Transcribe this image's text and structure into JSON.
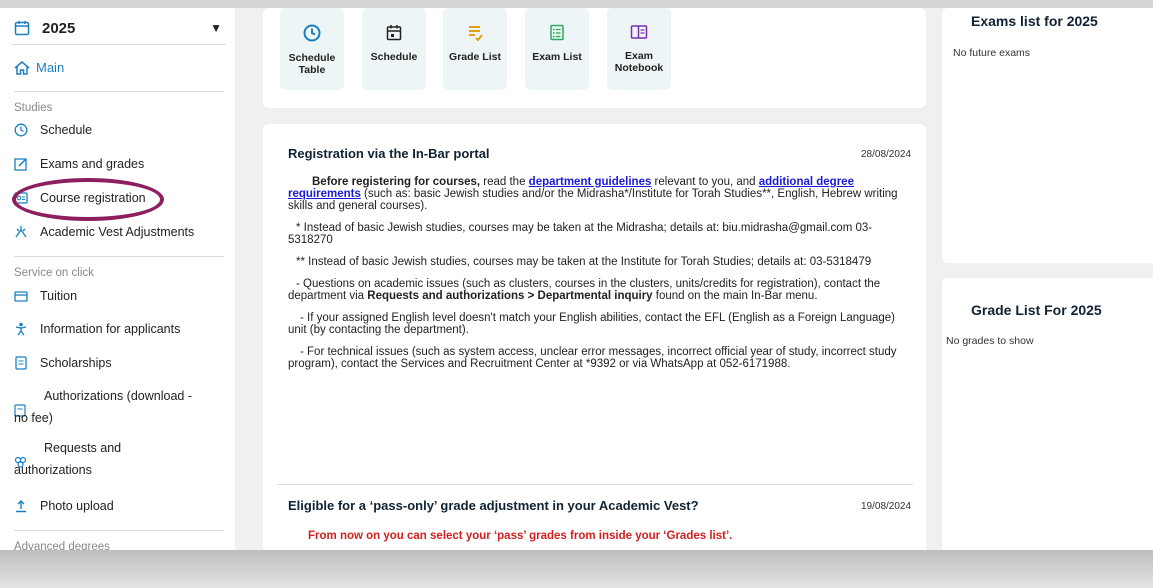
{
  "sidebar": {
    "year": "2025",
    "main": "Main",
    "studies_label": "Studies",
    "items_studies": [
      "Schedule",
      "Exams and grades",
      "Course registration",
      "Academic Vest Adjustments"
    ],
    "service_label": "Service on click",
    "items_service": [
      "Tuition",
      "Information for applicants",
      "Scholarships"
    ],
    "auth_download_1": "Authorizations (download -",
    "auth_download_2": "no fee)",
    "requests_1": "Requests and",
    "requests_2": "authorizations",
    "photo_upload": "Photo upload",
    "advanced_label": "Advanced degrees"
  },
  "tiles": [
    {
      "l1": "Schedule",
      "l2": "Table"
    },
    {
      "l1": "Schedule",
      "l2": ""
    },
    {
      "l1": "Grade List",
      "l2": ""
    },
    {
      "l1": "Exam List",
      "l2": ""
    },
    {
      "l1": "Exam",
      "l2": "Notebook"
    }
  ],
  "news1": {
    "title": "Registration via the In-Bar portal",
    "date": "28/08/2024",
    "p1_bold": "Before registering for courses,",
    "p1_a": " read the ",
    "p1_link1": "department guidelines",
    "p1_b": " relevant to you, and ",
    "p1_link2": "additional degree requirements",
    "p1_c": " (such as: basic Jewish studies and/or the Midrasha*/Institute for Torah Studies**, English, Hebrew writing skills and general courses).",
    "p2": "* Instead of basic Jewish studies, courses may be taken at the Midrasha; details at: biu.midrasha@gmail.com 03-5318270",
    "p3": "** Instead of basic Jewish studies, courses may be taken at the Institute for Torah Studies; details at: 03-5318479",
    "p4_a": "- Questions on academic issues (such as clusters, courses in the clusters, units/credits for registration), contact the department via ",
    "p4_bold": "Requests and authorizations > Departmental inquiry",
    "p4_b": " found on the main In-Bar menu.",
    "p5": "- If your assigned English level doesn't match your English abilities, contact the EFL (English as a Foreign Language) unit (by contacting the department).",
    "p6": "- For technical issues (such as system access, unclear error messages, incorrect official year of study, incorrect study program), contact the Services and Recruitment Center at *9392 or via WhatsApp at 052-6171988."
  },
  "news2": {
    "title": "Eligible for a ‘pass-only’ grade adjustment in your Academic Vest?",
    "date": "19/08/2024",
    "red": "From now on you can select your ‘pass’ grades  from inside  your ‘Grades list’."
  },
  "right": {
    "exams_title": "Exams list for 2025",
    "exams_empty": "No future exams",
    "grades_title": "Grade List For 2025",
    "grades_empty": "No grades to show"
  }
}
